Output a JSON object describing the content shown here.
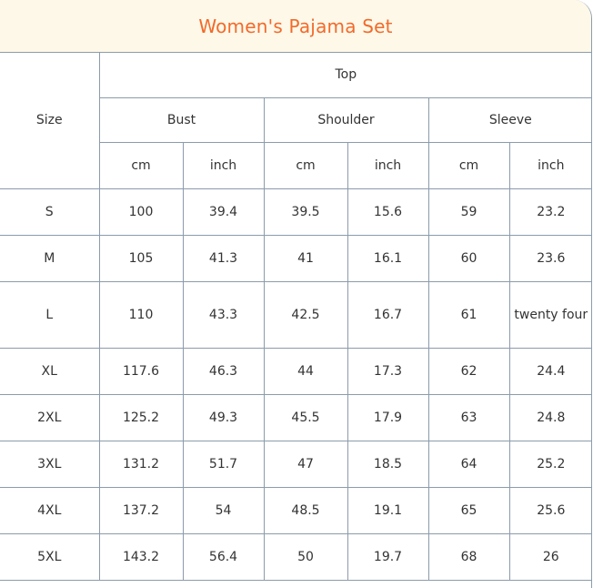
{
  "title": "Women's Pajama Set",
  "table": {
    "size_header": "Size",
    "group_header": "Top",
    "measurements": [
      {
        "label": "Bust",
        "units": [
          "cm",
          "inch"
        ]
      },
      {
        "label": "Shoulder",
        "units": [
          "cm",
          "inch"
        ]
      },
      {
        "label": "Sleeve",
        "units": [
          "cm",
          "inch"
        ]
      }
    ],
    "rows": [
      {
        "size": "S",
        "values": [
          "100",
          "39.4",
          "39.5",
          "15.6",
          "59",
          "23.2"
        ]
      },
      {
        "size": "M",
        "values": [
          "105",
          "41.3",
          "41",
          "16.1",
          "60",
          "23.6"
        ]
      },
      {
        "size": "L",
        "values": [
          "110",
          "43.3",
          "42.5",
          "16.7",
          "61",
          "twenty four"
        ]
      },
      {
        "size": "XL",
        "values": [
          "117.6",
          "46.3",
          "44",
          "17.3",
          "62",
          "24.4"
        ]
      },
      {
        "size": "2XL",
        "values": [
          "125.2",
          "49.3",
          "45.5",
          "17.9",
          "63",
          "24.8"
        ]
      },
      {
        "size": "3XL",
        "values": [
          "131.2",
          "51.7",
          "47",
          "18.5",
          "64",
          "25.2"
        ]
      },
      {
        "size": "4XL",
        "values": [
          "137.2",
          "54",
          "48.5",
          "19.1",
          "65",
          "25.6"
        ]
      },
      {
        "size": "5XL",
        "values": [
          "143.2",
          "56.4",
          "50",
          "19.7",
          "68",
          "26"
        ]
      }
    ]
  },
  "colors": {
    "title": "#f26a2a",
    "title_background": "#fef8e9",
    "border": "#8c9bab",
    "text": "#333333"
  }
}
